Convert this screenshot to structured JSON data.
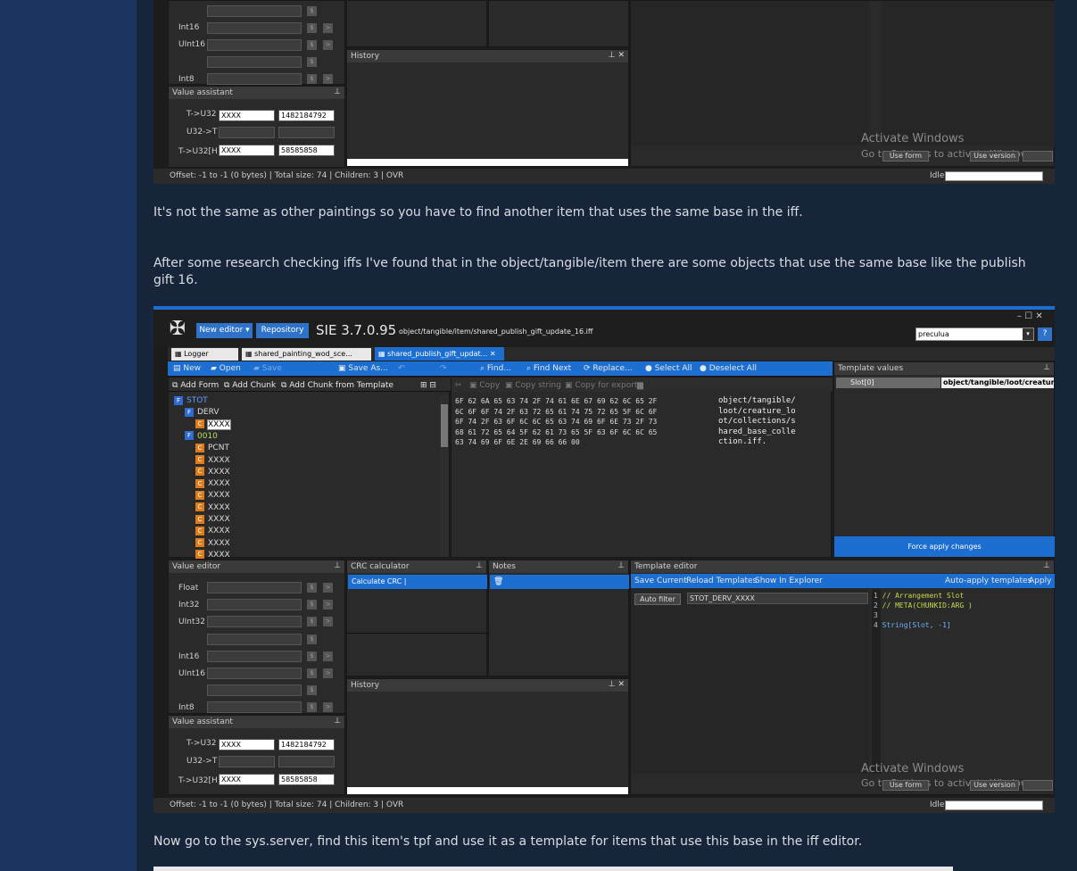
{
  "para1": "It's not the same as other paintings so you have to find another item that uses the same base in the iff.",
  "para2": "After some research checking iffs I've found that in the object/tangible/item there are some objects that use the same base like the publish gift 16.",
  "para3": "Now go to the sys.server, find this item's tpf and use it as a template for items that use this base in the iff editor.",
  "app": {
    "new_editor": "New editor ▾",
    "repository": "Repository",
    "title": "SIE 3.7.0.95",
    "path": "object/tangible/item/shared_publish_gift_update_16.iff",
    "search_value": "preculua",
    "tabs": [
      "Logger",
      "shared_painting_wod_sce...",
      "shared_publish_gift_updat..."
    ],
    "toolbar": [
      "New",
      "Open",
      "Save",
      "Save As...",
      "Find...",
      "Find Next",
      "Replace...",
      "Select All",
      "Deselect All"
    ],
    "add_form": "Add Form",
    "add_chunk": "Add Chunk",
    "add_chunk_tpl": "Add Chunk from Template",
    "hex_toolbar": [
      "Copy",
      "Copy string",
      "Copy for export"
    ],
    "tree": [
      {
        "t": "F",
        "label": "STOT",
        "lvl": 0
      },
      {
        "t": "F",
        "label": "DERV",
        "lvl": 1
      },
      {
        "t": "C",
        "label": "XXXX",
        "lvl": 2,
        "sel": true
      },
      {
        "t": "F",
        "label": "0010",
        "lvl": 1
      },
      {
        "t": "C",
        "label": "PCNT",
        "lvl": 2
      },
      {
        "t": "C",
        "label": "XXXX",
        "lvl": 2
      },
      {
        "t": "C",
        "label": "XXXX",
        "lvl": 2
      },
      {
        "t": "C",
        "label": "XXXX",
        "lvl": 2
      },
      {
        "t": "C",
        "label": "XXXX",
        "lvl": 2
      },
      {
        "t": "C",
        "label": "XXXX",
        "lvl": 2
      },
      {
        "t": "C",
        "label": "XXXX",
        "lvl": 2
      },
      {
        "t": "C",
        "label": "XXXX",
        "lvl": 2
      },
      {
        "t": "C",
        "label": "XXXX",
        "lvl": 2
      },
      {
        "t": "C",
        "label": "XXXX",
        "lvl": 2
      }
    ],
    "hex_lines": [
      "6F 62 6A 65 63 74 2F 74 61 6E 67 69 62 6C 65 2F",
      "6C 6F 6F 74 2F 63 72 65 61 74 75 72 65 5F 6C 6F",
      "6F 74 2F 63 6F 6C 6C 65 63 74 69 6F 6E 73 2F 73",
      "68 61 72 65 64 5F 62 61 73 65 5F 63 6F 6C 6C 65",
      "63 74 69 6F 6E 2E 69 66 66 00"
    ],
    "ascii_lines": [
      "object/tangible/",
      "loot/creature_lo",
      "ot/collections/s",
      "hared_base_colle",
      "ction.iff."
    ],
    "template_values": "Template values",
    "slot_label": "Slot[0]",
    "slot_value": "object/tangible/loot/creature_",
    "force_apply": "Force apply changes",
    "value_editor": "Value editor",
    "ve_labels": [
      "Float",
      "Int32",
      "UInt32",
      "",
      "Int16",
      "UInt16",
      "",
      "Int8"
    ],
    "crc": "CRC calculator",
    "calc_crc": "Calculate CRC",
    "notes": "Notes",
    "history": "History",
    "template_editor": "Template editor",
    "save_current": "Save Current",
    "reload_templates": "Reload Templates",
    "show_explorer": "Show In Explorer",
    "auto_apply": "Auto-apply templates",
    "apply": "Apply",
    "auto_filter": "Auto filter",
    "filter_value": "STOT_DERV_XXXX",
    "code": [
      "// Arrangement Slot",
      "// META(CHUNKID:ARG )",
      "",
      "String[Slot, -1]"
    ],
    "value_assistant": "Value assistant",
    "va_labels": [
      "T->U32",
      "U32->T",
      "T->U32[H]"
    ],
    "va_in": [
      "XXXX",
      "",
      "XXXX"
    ],
    "va_out": [
      "1482184792",
      "",
      "58585858"
    ],
    "status": "Offset: -1 to -1 (0 bytes)  |  Total size: 74  |  Children: 3  |  OVR",
    "idle": "Idle",
    "activate_title": "Activate Windows",
    "activate_sub": "Go to Settings to activate Windows.",
    "use_form": "Use form",
    "use_version": "Use version"
  }
}
